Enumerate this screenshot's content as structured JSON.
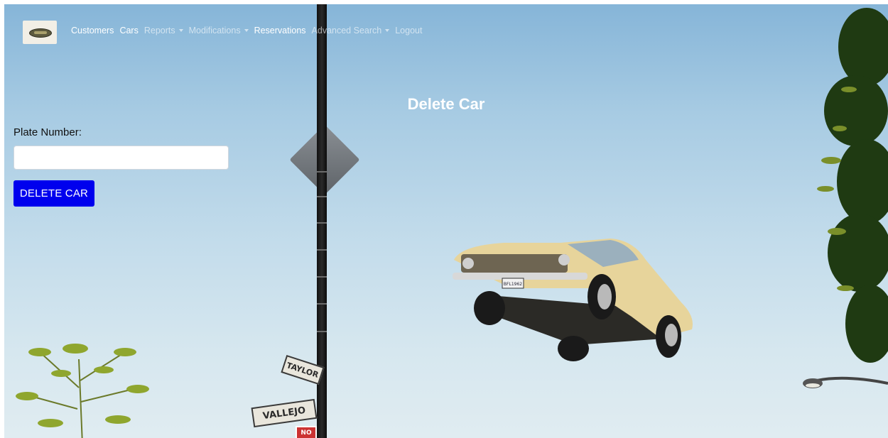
{
  "navbar": {
    "brand_alt": "brand-logo",
    "items": [
      {
        "label": "Customers",
        "dropdown": false,
        "muted": false
      },
      {
        "label": "Cars",
        "dropdown": false,
        "muted": false
      },
      {
        "label": "Reports",
        "dropdown": true,
        "muted": true
      },
      {
        "label": "Modifications",
        "dropdown": true,
        "muted": true
      },
      {
        "label": "Reservations",
        "dropdown": false,
        "muted": false
      },
      {
        "label": "Advanced Search",
        "dropdown": true,
        "muted": true
      },
      {
        "label": "Logout",
        "dropdown": false,
        "muted": true
      }
    ]
  },
  "page": {
    "title": "Delete Car"
  },
  "form": {
    "plate_label": "Plate Number:",
    "plate_value": "",
    "plate_placeholder": "",
    "submit_label": "DELETE CAR"
  },
  "background": {
    "signs": {
      "taylor": "TAYLOR",
      "vallejo": "VALLEJO",
      "no": "NO"
    },
    "license_plate": "BFL1962"
  },
  "colors": {
    "button": "#0000ee",
    "sky_top": "#86b5d8",
    "sky_bottom": "#e0ecf1",
    "title_text": "#ffffff"
  }
}
